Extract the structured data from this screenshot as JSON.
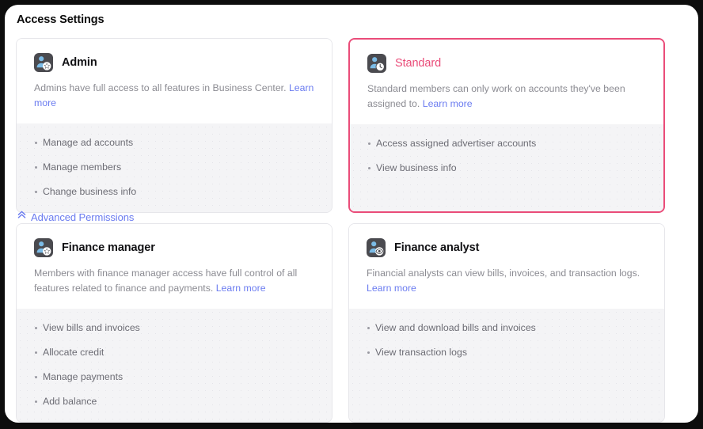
{
  "page": {
    "title": "Access Settings",
    "background_color": "#0d0d0d",
    "panel_color": "#ffffff"
  },
  "colors": {
    "accent_selected": "#ea4c79",
    "link": "#6b7cf0",
    "body_text": "#8b8b92",
    "perm_text": "#6c6c74",
    "perm_background": "#f4f4f6",
    "card_border": "#e6e6ea",
    "icon_tile": "#4a4a4f",
    "icon_person": "#7bbbe6"
  },
  "advanced_toggle": {
    "label": "Advanced Permissions",
    "icon": "double-chevron-up-icon",
    "expanded": true
  },
  "roles_basic": [
    {
      "id": "admin",
      "name": "Admin",
      "icon": "person-star-icon",
      "selected": false,
      "description": "Admins have full access to all features in Business Center. ",
      "link_text": "Learn more",
      "link_position": "after",
      "permissions": [
        "Manage ad accounts",
        "Manage members",
        "Change business info"
      ],
      "permission_columns": 2
    },
    {
      "id": "standard",
      "name": "Standard",
      "icon": "person-clock-icon",
      "selected": true,
      "description": "Standard members can only work on accounts they've been assigned to. ",
      "link_text": "Learn more",
      "link_position": "after",
      "permissions": [
        "Access assigned advertiser accounts",
        "View business info"
      ],
      "permission_columns": 1
    }
  ],
  "roles_advanced": [
    {
      "id": "finance-manager",
      "name": "Finance manager",
      "icon": "person-star-icon",
      "selected": false,
      "description": "Members with finance manager access have full control of all features related to finance and payments. ",
      "link_text": "Learn more",
      "link_position": "after",
      "permissions": [
        "View bills and invoices",
        "Allocate credit",
        "Manage payments",
        "Add balance"
      ],
      "permission_columns": 2
    },
    {
      "id": "finance-analyst",
      "name": "Finance analyst",
      "icon": "person-eye-icon",
      "selected": false,
      "description": "Financial analysts can view bills, invoices, and transaction logs. ",
      "link_text": "Learn more",
      "link_position": "after",
      "permissions": [
        "View and download bills and invoices",
        "View transaction logs"
      ],
      "permission_columns": 1
    }
  ]
}
